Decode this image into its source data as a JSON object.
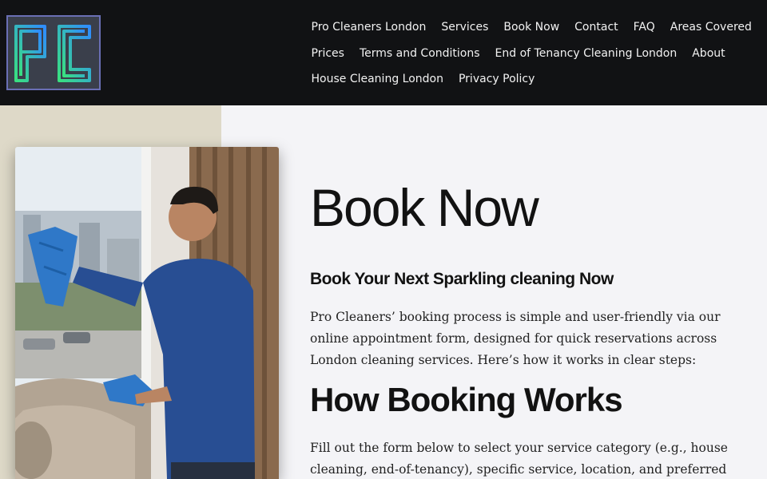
{
  "header": {
    "logo_text": "PC",
    "nav_rows": [
      [
        "Pro Cleaners London",
        "Services",
        "Book Now",
        "Contact",
        "FAQ",
        "Areas Covered"
      ],
      [
        "Prices",
        "Terms and Conditions",
        "End of Tenancy Cleaning London",
        "About"
      ],
      [
        "House Cleaning London",
        "Privacy Policy"
      ]
    ]
  },
  "main": {
    "title": "Book Now",
    "subtitle": "Book Your Next Sparkling cleaning Now",
    "intro": "Pro Cleaners’ booking process is simple and user-friendly via our online appointment form, designed for quick reservations across London cleaning services. Here’s how it works in clear steps:",
    "section_heading": "How Booking Works",
    "section_text": "Fill out the form below to select your service category (e.g., house cleaning, end-of-tenancy), specific service, location, and preferred"
  },
  "colors": {
    "header_bg": "#111214",
    "page_bg": "#f4f4f7",
    "side_panel": "#ded9c8",
    "logo_gradient_start": "#39e07f",
    "logo_gradient_end": "#2f8cff"
  }
}
